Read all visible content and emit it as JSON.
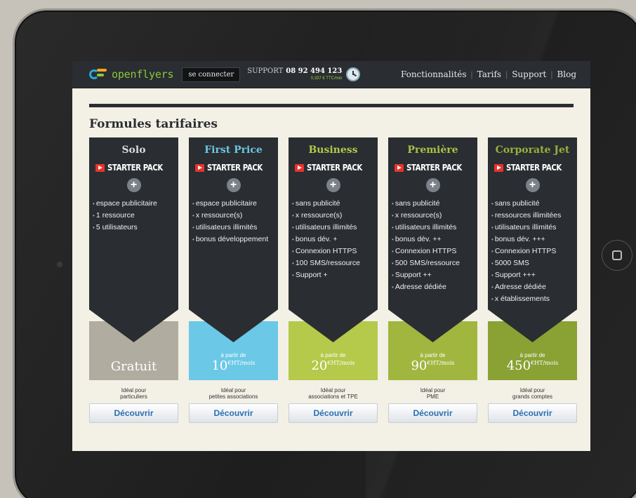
{
  "header": {
    "logo_text": "openflyers",
    "login_label": "se connecter",
    "support_label": "SUPPORT",
    "support_phone": "08 92 494 123",
    "support_price": "0,337 € TTC/min",
    "nav": [
      "Fonctionnalités",
      "Tarifs",
      "Support",
      "Blog"
    ]
  },
  "page_title": "Formules tarifaires",
  "starter_label": "STARTER PACK",
  "ideal_label": "Idéal pour",
  "discover_label": "Découvrir",
  "from_label": "à partir de",
  "price_unit": "€HT/mois",
  "colors": {
    "dark": "#2a2d31",
    "solo": "#b0aca0",
    "first_price": "#6bc8e6",
    "business": "#b5c94a",
    "premiere": "#a0b63e",
    "corporate": "#8aa134",
    "name_solo": "#d9d9d9",
    "name_first": "#6bc8e6",
    "name_business": "#b5c94a",
    "name_premiere": "#a8c148",
    "name_corporate": "#98b13c"
  },
  "plans": [
    {
      "name": "Solo",
      "features": [
        "espace publicitaire",
        "1 ressource",
        "5 utilisateurs"
      ],
      "price_text": "Gratuit",
      "audience": "particuliers"
    },
    {
      "name": "First Price",
      "features": [
        "espace publicitaire",
        "x ressource(s)",
        "utilisateurs illimités",
        "bonus développement"
      ],
      "price": "10",
      "audience": "petites associations"
    },
    {
      "name": "Business",
      "features": [
        "sans publicité",
        "x ressource(s)",
        "utilisateurs illimités",
        "bonus dév. +",
        "Connexion HTTPS",
        "100 SMS/ressource",
        "Support +"
      ],
      "price": "20",
      "audience": "associations et TPE"
    },
    {
      "name": "Première",
      "features": [
        "sans publicité",
        "x ressource(s)",
        "utilisateurs illimités",
        "bonus dév. ++",
        "Connexion HTTPS",
        "500 SMS/ressource",
        "Support ++",
        "Adresse  dédiée"
      ],
      "price": "90",
      "audience": "PME"
    },
    {
      "name": "Corporate Jet",
      "features": [
        "sans publicité",
        "ressources illimitées",
        "utilisateurs illimités",
        "bonus dév. +++",
        "Connexion HTTPS",
        "5000 SMS",
        "Support +++",
        "Adresse dédiée",
        "x établissements"
      ],
      "price": "450",
      "audience": "grands comptes"
    }
  ]
}
